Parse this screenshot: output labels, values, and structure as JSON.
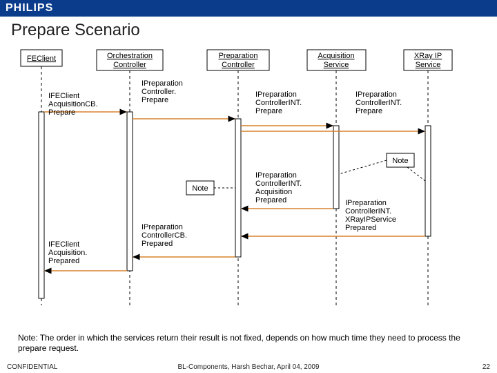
{
  "brand": "PHILIPS",
  "title": "Prepare Scenario",
  "lifelines": {
    "l1": "FEClient",
    "l2": "Orchestration\nController",
    "l3": "Preparation\nController",
    "l4": "Acquisition\nService",
    "l5": "XRay IP\nService"
  },
  "messages": {
    "m1": "IFEClient\nAcquisitionCB.\nPrepare",
    "m2": "IPreparation\nController.\nPrepare",
    "m3": "IPreparation\nControllerINT.\nPrepare",
    "m4": "IPreparation\nControllerINT.\nPrepare",
    "m5": "IPreparation\nControllerINT.\nAcquisition\nPrepared",
    "m6": "IPreparation\nControllerINT.\nXRayIPService\nPrepared",
    "m7": "IPreparation\nControllerCB.\nPrepared",
    "m8": "IFEClient\nAcquisition.\nPrepared"
  },
  "noteLabel": "Note",
  "bottomNote": "Note: The order in which the services return their result is not fixed, depends on how much time they need to process the prepare request.",
  "footer": {
    "left": "CONFIDENTIAL",
    "center": "BL-Components, Harsh Bechar, April 04, 2009",
    "right": "22"
  }
}
